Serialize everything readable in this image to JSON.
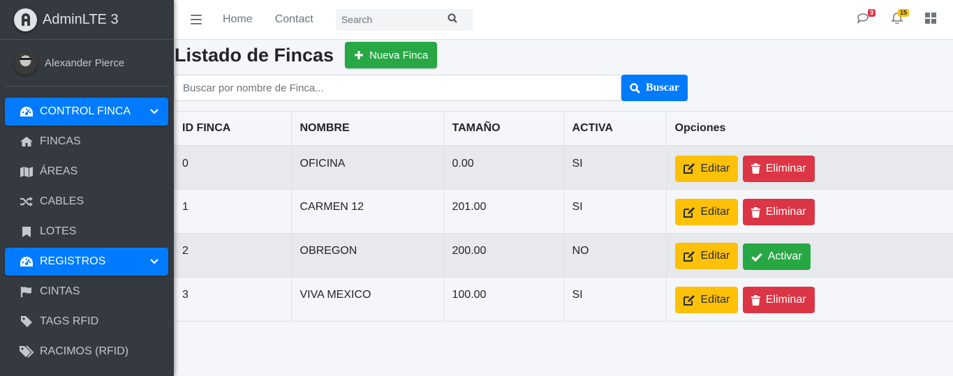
{
  "brand": {
    "title": "AdminLTE 3"
  },
  "user": {
    "name": "Alexander Pierce"
  },
  "sidebar": {
    "items": [
      {
        "label": "CONTROL FINCA",
        "icon": "tachometer-icon",
        "active": true
      },
      {
        "label": "FINCAS",
        "icon": "home-icon",
        "active": false
      },
      {
        "label": "ÁREAS",
        "icon": "map-icon",
        "active": false
      },
      {
        "label": "CABLES",
        "icon": "random-icon",
        "active": false
      },
      {
        "label": "LOTES",
        "icon": "bookmark-icon",
        "active": false
      },
      {
        "label": "REGISTROS",
        "icon": "tachometer-icon",
        "active": true
      },
      {
        "label": "CINTAS",
        "icon": "flag-icon",
        "active": false
      },
      {
        "label": "TAGS RFID",
        "icon": "tag-icon",
        "active": false
      },
      {
        "label": "RACIMOS (RFID)",
        "icon": "tags-icon",
        "active": false
      }
    ]
  },
  "topbar": {
    "links": [
      "Home",
      "Contact"
    ],
    "search_placeholder": "Search",
    "messages_count": "3",
    "notifications_count": "15"
  },
  "page": {
    "title": "Listado de Fincas",
    "new_button": "Nueva Finca",
    "filter_placeholder": "Buscar por nombre de Finca...",
    "search_button": "Buscar"
  },
  "table": {
    "headers": [
      "ID FINCA",
      "NOMBRE",
      "TAMAÑO",
      "ACTIVA",
      "Opciones"
    ],
    "rows": [
      {
        "id": "0",
        "nombre": "OFICINA",
        "tamano": "0.00",
        "activa": "SI",
        "edit": "Editar",
        "action": "Eliminar"
      },
      {
        "id": "1",
        "nombre": "CARMEN 12",
        "tamano": "201.00",
        "activa": "SI",
        "edit": "Editar",
        "action": "Eliminar"
      },
      {
        "id": "2",
        "nombre": "OBREGON",
        "tamano": "200.00",
        "activa": "NO",
        "edit": "Editar",
        "action": "Activar"
      },
      {
        "id": "3",
        "nombre": "VIVA MEXICO",
        "tamano": "100.00",
        "activa": "SI",
        "edit": "Editar",
        "action": "Eliminar"
      }
    ]
  },
  "colors": {
    "primary": "#007bff",
    "success": "#28a745",
    "warning": "#ffc107",
    "danger": "#dc3545",
    "sidebar": "#343a40"
  }
}
